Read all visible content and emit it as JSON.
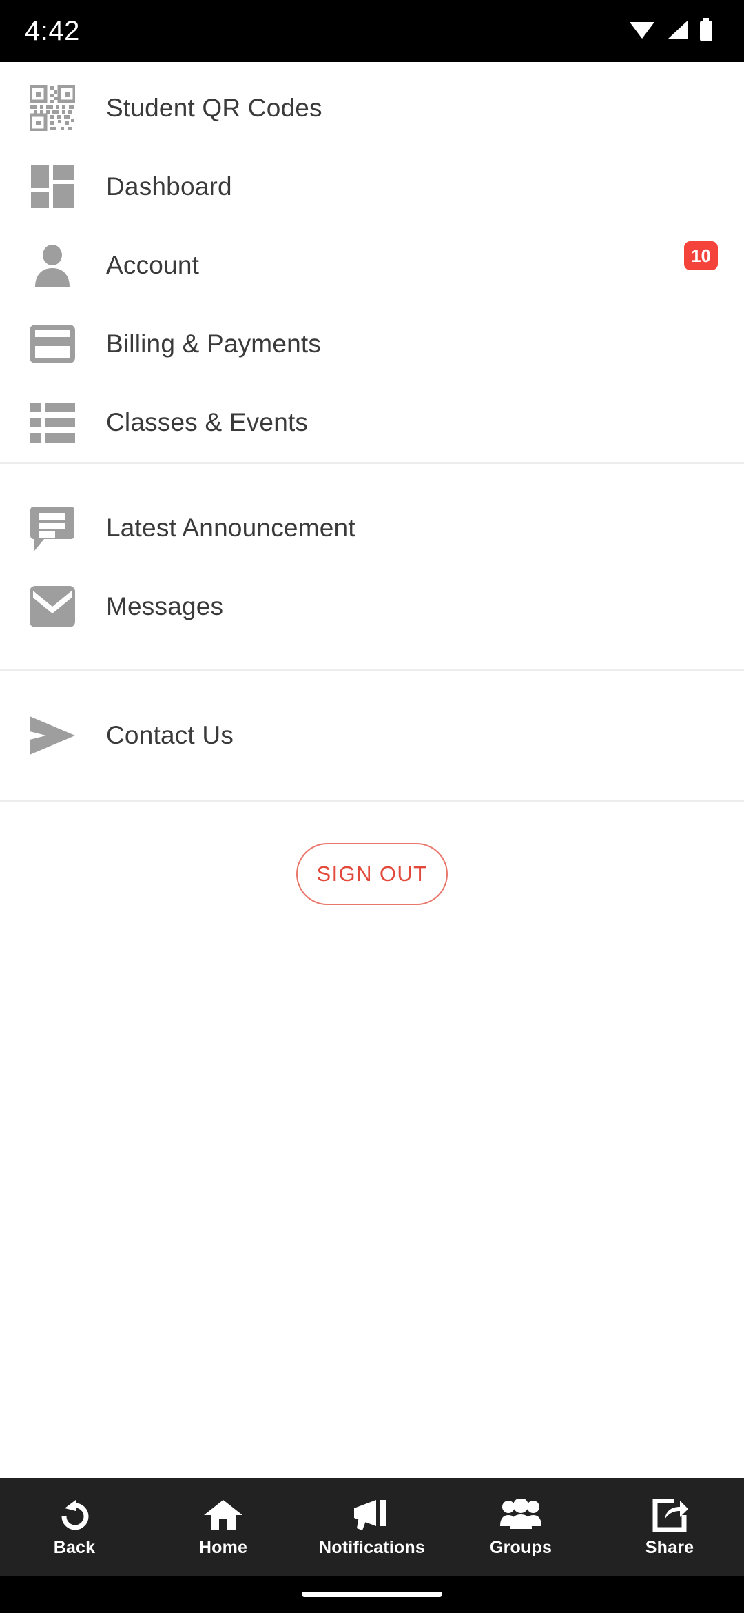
{
  "status_bar": {
    "time": "4:42",
    "icons": [
      "wifi-icon",
      "cell-signal-icon",
      "battery-icon"
    ],
    "background": "#000000"
  },
  "menu": {
    "groups": [
      {
        "items": [
          {
            "label": "Student QR Codes",
            "icon": "qr-code-icon",
            "badge": null
          },
          {
            "label": "Dashboard",
            "icon": "dashboard-grid-icon",
            "badge": null
          },
          {
            "label": "Account",
            "icon": "person-icon",
            "badge": "10"
          },
          {
            "label": "Billing & Payments",
            "icon": "credit-card-icon",
            "badge": null
          },
          {
            "label": "Classes & Events",
            "icon": "list-icon",
            "badge": null
          }
        ]
      },
      {
        "items": [
          {
            "label": "Latest Announcement",
            "icon": "speech-bubble-icon",
            "badge": null
          },
          {
            "label": "Messages",
            "icon": "envelope-icon",
            "badge": null
          }
        ]
      },
      {
        "items": [
          {
            "label": "Contact Us",
            "icon": "send-arrow-icon",
            "badge": null
          }
        ]
      }
    ]
  },
  "sign_out": {
    "label": "SIGN OUT",
    "accent_color": "#e2493a",
    "border_color": "#e8766a"
  },
  "bottom_nav": {
    "background": "#222222",
    "items": [
      {
        "label": "Back",
        "icon": "back-arrow-icon"
      },
      {
        "label": "Home",
        "icon": "home-icon"
      },
      {
        "label": "Notifications",
        "icon": "megaphone-icon"
      },
      {
        "label": "Groups",
        "icon": "people-group-icon"
      },
      {
        "label": "Share",
        "icon": "share-icon"
      }
    ]
  },
  "colors": {
    "icon_gray": "#9e9e9e",
    "label_text": "#3a3a3a",
    "badge_red": "#f4433a",
    "divider": "#eceded"
  }
}
